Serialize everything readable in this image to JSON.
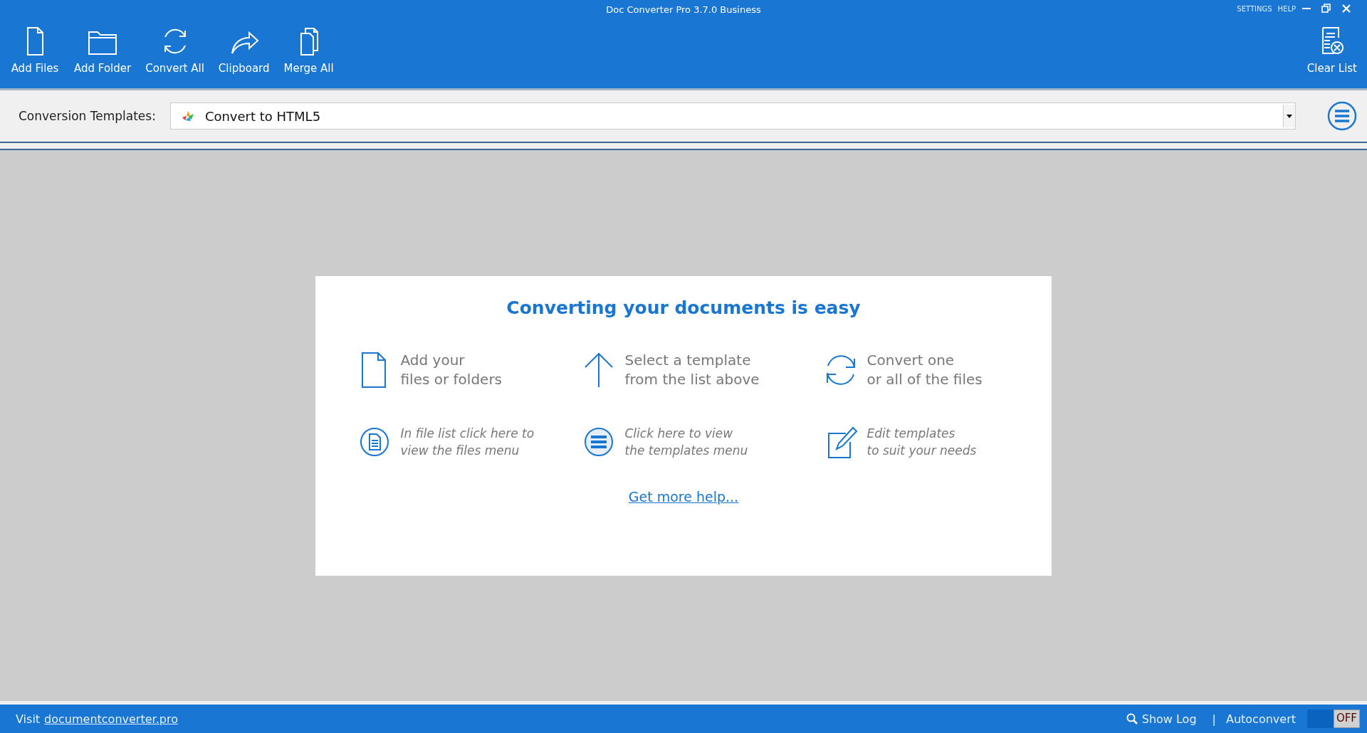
{
  "window": {
    "title": "Doc Converter Pro 3.7.0 Business",
    "links": [
      "SETTINGS",
      "HELP"
    ]
  },
  "toolbar": [
    {
      "label": "Add Files",
      "kind": "file"
    },
    {
      "label": "Add Folder",
      "kind": "folder"
    },
    {
      "label": "Convert All",
      "kind": "convert"
    },
    {
      "label": "Clipboard",
      "kind": "share"
    },
    {
      "label": "Merge All",
      "kind": "merge"
    }
  ],
  "toolbar_right": {
    "label": "Clear List",
    "kind": "clear"
  },
  "templates": {
    "label": "Conversion Templates:",
    "value": "Convert to HTML5"
  },
  "help_card": {
    "title": "Converting your documents is easy",
    "steps": [
      {
        "kind": "file",
        "lines": [
          "Add your",
          "files or folders"
        ]
      },
      {
        "kind": "arrow",
        "lines": [
          "Select a template",
          "from the list above"
        ]
      },
      {
        "kind": "convert",
        "lines": [
          "Convert one",
          "or all of the files"
        ]
      },
      {
        "kind": "doc-circle",
        "lines": [
          "In file list click here to",
          "view the files menu"
        ]
      },
      {
        "kind": "menu-circle",
        "lines": [
          "Click here to view",
          "the templates menu"
        ]
      },
      {
        "kind": "edit",
        "lines": [
          "Edit templates",
          "to suit your needs"
        ]
      }
    ],
    "link": "Get more help..."
  },
  "status_bar": {
    "visit": "Visit",
    "site": "documentconverter.pro",
    "show_log": "Show Log",
    "separator": "|",
    "autoconvert": {
      "label": "Autoconvert",
      "on": false,
      "state_text": "OFF"
    }
  }
}
